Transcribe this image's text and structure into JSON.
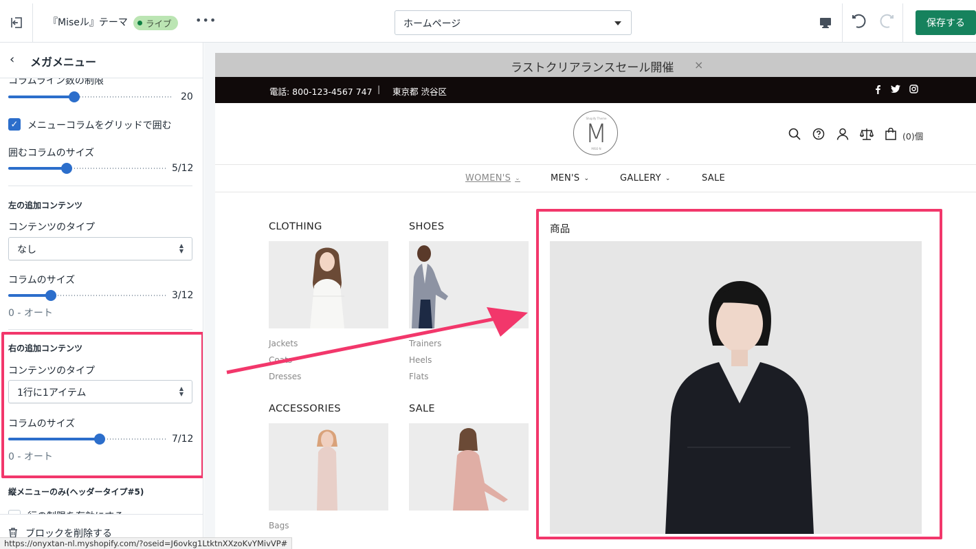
{
  "topbar": {
    "theme_name": "『Miseル』テーマ",
    "live_badge": "ライブ",
    "more": "•••",
    "page_select": "ホームページ",
    "save_label": "保存する"
  },
  "sidebar": {
    "title": "メガメニュー",
    "column_line_limit_label": "コラムライン数の制限",
    "column_line_limit_value": "20",
    "column_line_limit_level": 0.4,
    "grid_checkbox_label": "メニューコラムをグリッドで囲む",
    "grid_checkbox_checked": true,
    "wrap_size_label": "囲むコラムのサイズ",
    "wrap_size_value": "5/12",
    "wrap_size_level": 0.37,
    "left_section_title": "左の追加コンテンツ",
    "left_content_type_label": "コンテンツのタイプ",
    "left_content_type_value": "なし",
    "left_column_size_label": "コラムのサイズ",
    "left_column_size_value": "3/12",
    "left_column_size_level": 0.27,
    "left_note": "0 - オート",
    "right_section_title": "右の追加コンテンツ",
    "right_content_type_label": "コンテンツのタイプ",
    "right_content_type_value": "1行に1アイテム",
    "right_column_size_label": "コラムのサイズ",
    "right_column_size_value": "7/12",
    "right_column_size_level": 0.58,
    "right_note": "0 - オート",
    "vertical_menu_title": "縦メニューのみ(ヘッダータイプ#5)",
    "vertical_menu_checkbox_label": "行の制限を有効にする",
    "delete_block_label": "ブロックを削除する"
  },
  "preview": {
    "announcement": "ラストクリアランスセール開催",
    "announcement_close": "×",
    "phone": "電話: 800-123-4567 747",
    "separator": "|",
    "location": "東京都 渋谷区",
    "logo_letter": "M",
    "logo_top_text": "Shopify Theme",
    "logo_bottom_text": "MISE-N",
    "cart_count": "(0)個",
    "nav": [
      "WOMEN'S",
      "MEN'S",
      "GALLERY",
      "SALE"
    ],
    "megamenu": {
      "clothing": {
        "title": "CLOTHING",
        "links": [
          "Jackets",
          "Coats",
          "Dresses"
        ]
      },
      "shoes": {
        "title": "SHOES",
        "links": [
          "Trainers",
          "Heels",
          "Flats"
        ]
      },
      "accessories": {
        "title": "ACCESSORIES",
        "links": [
          "Bags"
        ]
      },
      "sale": {
        "title": "SALE",
        "links": []
      },
      "product_title": "商品"
    }
  },
  "statusbar_url": "https://onyxtan-nl.myshopify.com/?oseid=J6ovkg1LtktnXXzoKvYMivVP#",
  "colors": {
    "accent": "#2c6ecb",
    "save": "#16825d",
    "highlight": "#f2376b",
    "live": "#bbe5b3"
  },
  "icons": [
    "exit-icon",
    "more-icon",
    "desktop-icon",
    "undo-icon",
    "redo-icon",
    "back-chevron-icon",
    "checkbox-icon",
    "trash-icon",
    "facebook-icon",
    "twitter-icon",
    "instagram-icon",
    "search-icon",
    "help-icon",
    "user-icon",
    "compare-icon",
    "cart-icon",
    "arrow-icon"
  ]
}
